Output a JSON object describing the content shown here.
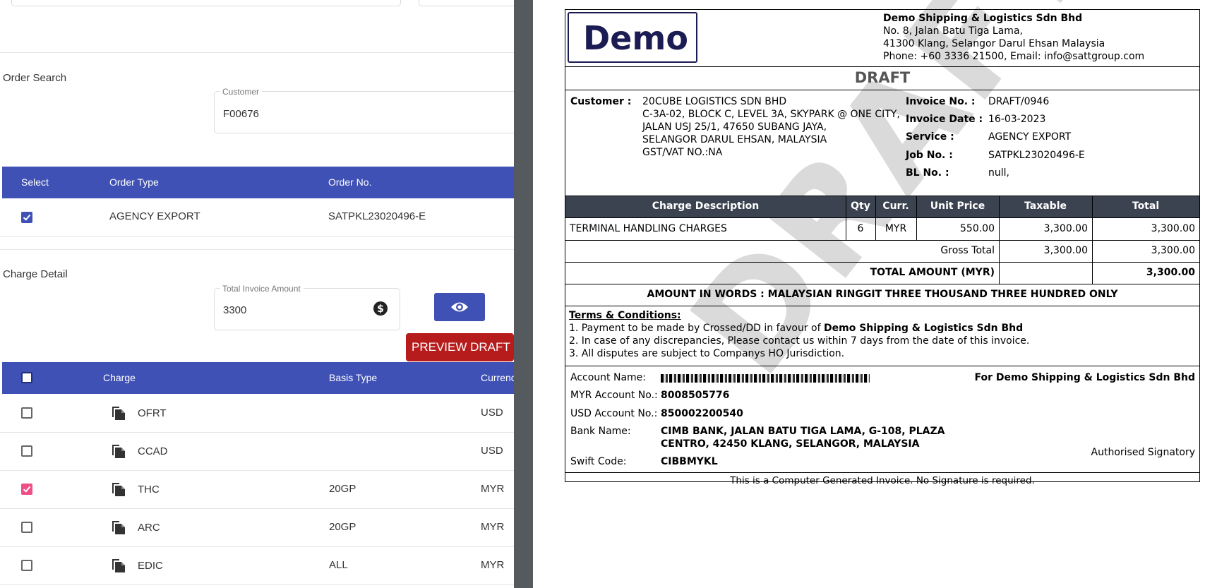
{
  "order_search": {
    "title": "Order Search",
    "customer_label": "Customer",
    "customer_value": "F00676"
  },
  "orders_table": {
    "headers": [
      "Select",
      "Order Type",
      "Order No."
    ],
    "rows": [
      {
        "selected": true,
        "order_type": "AGENCY EXPORT",
        "order_no": "SATPKL23020496-E"
      }
    ]
  },
  "charge_detail": {
    "title": "Charge Detail",
    "total_label": "Total Invoice Amount",
    "total_value": "3300",
    "preview_label": "PREVIEW DRAFT"
  },
  "charges_table": {
    "headers": [
      "Charge",
      "Basis Type",
      "Currenc"
    ],
    "rows": [
      {
        "checked": false,
        "charge": "OFRT",
        "basis": "",
        "currency": "USD"
      },
      {
        "checked": false,
        "charge": "CCAD",
        "basis": "",
        "currency": "USD"
      },
      {
        "checked": true,
        "charge": "THC",
        "basis": "20GP",
        "currency": "MYR"
      },
      {
        "checked": false,
        "charge": "ARC",
        "basis": "20GP",
        "currency": "MYR"
      },
      {
        "checked": false,
        "charge": "EDIC",
        "basis": "ALL",
        "currency": "MYR"
      }
    ]
  },
  "invoice": {
    "logo": "Demo",
    "company": {
      "name": "Demo Shipping & Logistics Sdn Bhd",
      "address1": "No. 8, Jalan Batu Tiga Lama,",
      "address2": "41300 Klang, Selangor Darul Ehsan Malaysia",
      "contact": "Phone: +60 3336 21500, Email: info@sattgroup.com"
    },
    "status": "DRAFT",
    "watermark": "DRAFT",
    "customer_label": "Customer :",
    "customer_lines": [
      "20CUBE LOGISTICS SDN BHD",
      "C-3A-02, BLOCK C, LEVEL 3A, SKYPARK @ ONE CITY,",
      "JALAN USJ 25/1, 47650 SUBANG JAYA,",
      "SELANGOR DARUL EHSAN, MALAYSIA",
      "GST/VAT NO.:NA"
    ],
    "meta": [
      {
        "label": "Invoice No. :",
        "value": "DRAFT/0946"
      },
      {
        "label": "Invoice Date :",
        "value": "16-03-2023"
      },
      {
        "label": "Service :",
        "value": "AGENCY EXPORT"
      },
      {
        "label": "Job No. :",
        "value": "SATPKL23020496-E"
      },
      {
        "label": "BL No. :",
        "value": "null,"
      }
    ],
    "table_headers": [
      "Charge Description",
      "Qty",
      "Curr.",
      "Unit Price",
      "Taxable",
      "Total"
    ],
    "line": {
      "description": "TERMINAL HANDLING CHARGES",
      "qty": "6",
      "curr": "MYR",
      "unit_price": "550.00",
      "taxable": "3,300.00",
      "total": "3,300.00"
    },
    "gross_label": "Gross Total",
    "gross_taxable": "3,300.00",
    "gross_total": "3,300.00",
    "total_amount_label": "TOTAL AMOUNT (MYR)",
    "total_amount": "3,300.00",
    "amount_words": "AMOUNT IN WORDS : MALAYSIAN RINGGIT THREE THOUSAND THREE HUNDRED ONLY",
    "terms_title": "Terms & Conditions:",
    "term1_prefix": "1. Payment to be made by Crossed/DD in favour of ",
    "term1_company": "Demo Shipping & Logistics Sdn Bhd",
    "term2": "2. In case of any discrepancies, Please contact us within 7 days from the date of this invoice.",
    "term3": "3. All disputes are subject to Companys HO Jurisdiction.",
    "bank": {
      "account_name_label": "Account Name:",
      "myr_label": "MYR Account No.:",
      "myr_value": "8008505776",
      "usd_label": "USD Account No.:",
      "usd_value": "850002200540",
      "bank_name_label": "Bank Name:",
      "bank_name_line1": "CIMB BANK, JALAN BATU TIGA LAMA, G-108, PLAZA",
      "bank_name_line2": "CENTRO, 42450 KLANG, SELANGOR, MALAYSIA",
      "swift_label": "Swift Code:",
      "swift_value": "CIBBMYKL"
    },
    "for_company": "For Demo Shipping & Logistics Sdn Bhd",
    "signatory": "Authorised Signatory",
    "footer": "This is a Computer Generated Invoice. No Signature is required."
  }
}
